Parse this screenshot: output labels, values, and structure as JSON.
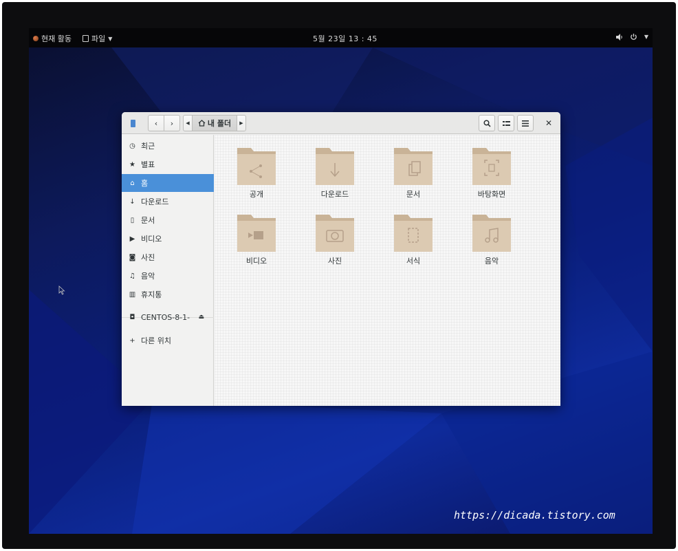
{
  "topbar": {
    "activities": "현재 활동",
    "app_menu": "파일",
    "clock": "5월 23일  13 : 45"
  },
  "window": {
    "breadcrumb": "내 폴더",
    "sidebar": [
      {
        "label": "최근",
        "icon": "clock-icon"
      },
      {
        "label": "별표",
        "icon": "star-icon"
      },
      {
        "label": "홈",
        "icon": "home-icon",
        "active": true
      },
      {
        "label": "다운로드",
        "icon": "download-icon"
      },
      {
        "label": "문서",
        "icon": "document-icon"
      },
      {
        "label": "비디오",
        "icon": "video-icon"
      },
      {
        "label": "사진",
        "icon": "camera-icon"
      },
      {
        "label": "음악",
        "icon": "music-icon"
      },
      {
        "label": "휴지통",
        "icon": "trash-icon"
      },
      {
        "label": "CENTOS-8-1-",
        "icon": "drive-icon"
      },
      {
        "label": "다른 위치",
        "icon": "plus-icon"
      }
    ],
    "folders": [
      {
        "label": "공개",
        "icon": "share-icon"
      },
      {
        "label": "다운로드",
        "icon": "download-icon"
      },
      {
        "label": "문서",
        "icon": "documents-icon"
      },
      {
        "label": "바탕화면",
        "icon": "desktop-icon"
      },
      {
        "label": "비디오",
        "icon": "video-icon"
      },
      {
        "label": "사진",
        "icon": "camera-icon"
      },
      {
        "label": "서식",
        "icon": "templates-icon"
      },
      {
        "label": "음악",
        "icon": "music-icon"
      }
    ]
  },
  "watermark": "https://dicada.tistory.com",
  "colors": {
    "accent": "#4a90d9",
    "folder": "#d9c4a8",
    "topbar": "#060608",
    "desktop": "#0d1a5c"
  }
}
